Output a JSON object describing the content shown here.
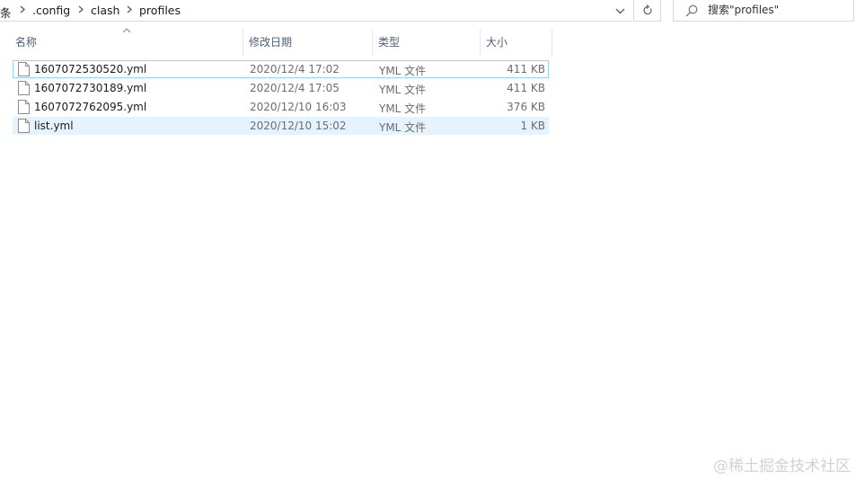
{
  "address_bar": {
    "crumbs": [
      "条",
      ".config",
      "clash",
      "profiles"
    ]
  },
  "search": {
    "placeholder": "搜索\"profiles\""
  },
  "columns": {
    "name": "名称",
    "modified": "修改日期",
    "type": "类型",
    "size": "大小"
  },
  "files": [
    {
      "name": "1607072530520.yml",
      "modified": "2020/12/4 17:02",
      "type": "YML 文件",
      "size": "411 KB"
    },
    {
      "name": "1607072730189.yml",
      "modified": "2020/12/4 17:05",
      "type": "YML 文件",
      "size": "411 KB"
    },
    {
      "name": "1607072762095.yml",
      "modified": "2020/12/10 16:03",
      "type": "YML 文件",
      "size": "376 KB"
    },
    {
      "name": "list.yml",
      "modified": "2020/12/10 15:02",
      "type": "YML 文件",
      "size": "1 KB"
    }
  ],
  "watermark": "@稀土掘金技术社区"
}
